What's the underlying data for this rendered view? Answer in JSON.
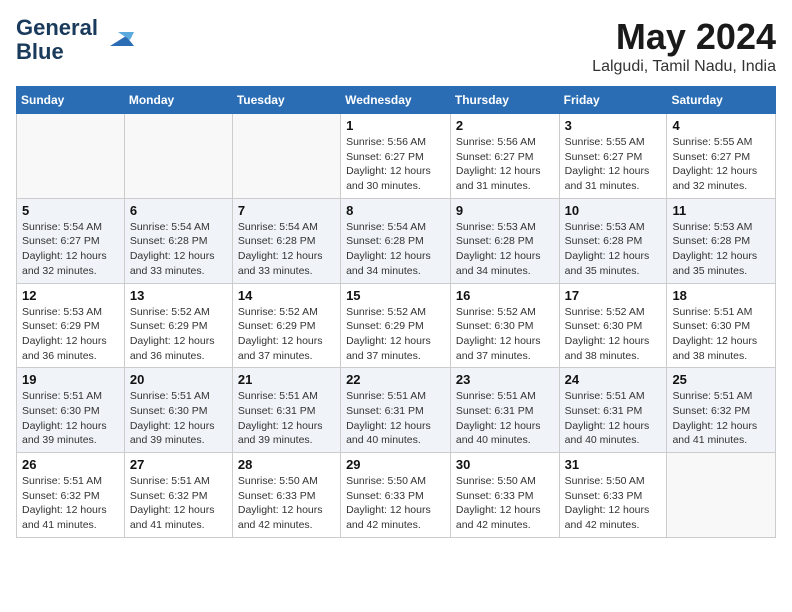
{
  "logo": {
    "line1": "General",
    "line2": "Blue"
  },
  "title": "May 2024",
  "subtitle": "Lalgudi, Tamil Nadu, India",
  "headers": [
    "Sunday",
    "Monday",
    "Tuesday",
    "Wednesday",
    "Thursday",
    "Friday",
    "Saturday"
  ],
  "weeks": [
    [
      {
        "day": "",
        "info": ""
      },
      {
        "day": "",
        "info": ""
      },
      {
        "day": "",
        "info": ""
      },
      {
        "day": "1",
        "info": "Sunrise: 5:56 AM\nSunset: 6:27 PM\nDaylight: 12 hours\nand 30 minutes."
      },
      {
        "day": "2",
        "info": "Sunrise: 5:56 AM\nSunset: 6:27 PM\nDaylight: 12 hours\nand 31 minutes."
      },
      {
        "day": "3",
        "info": "Sunrise: 5:55 AM\nSunset: 6:27 PM\nDaylight: 12 hours\nand 31 minutes."
      },
      {
        "day": "4",
        "info": "Sunrise: 5:55 AM\nSunset: 6:27 PM\nDaylight: 12 hours\nand 32 minutes."
      }
    ],
    [
      {
        "day": "5",
        "info": "Sunrise: 5:54 AM\nSunset: 6:27 PM\nDaylight: 12 hours\nand 32 minutes."
      },
      {
        "day": "6",
        "info": "Sunrise: 5:54 AM\nSunset: 6:28 PM\nDaylight: 12 hours\nand 33 minutes."
      },
      {
        "day": "7",
        "info": "Sunrise: 5:54 AM\nSunset: 6:28 PM\nDaylight: 12 hours\nand 33 minutes."
      },
      {
        "day": "8",
        "info": "Sunrise: 5:54 AM\nSunset: 6:28 PM\nDaylight: 12 hours\nand 34 minutes."
      },
      {
        "day": "9",
        "info": "Sunrise: 5:53 AM\nSunset: 6:28 PM\nDaylight: 12 hours\nand 34 minutes."
      },
      {
        "day": "10",
        "info": "Sunrise: 5:53 AM\nSunset: 6:28 PM\nDaylight: 12 hours\nand 35 minutes."
      },
      {
        "day": "11",
        "info": "Sunrise: 5:53 AM\nSunset: 6:28 PM\nDaylight: 12 hours\nand 35 minutes."
      }
    ],
    [
      {
        "day": "12",
        "info": "Sunrise: 5:53 AM\nSunset: 6:29 PM\nDaylight: 12 hours\nand 36 minutes."
      },
      {
        "day": "13",
        "info": "Sunrise: 5:52 AM\nSunset: 6:29 PM\nDaylight: 12 hours\nand 36 minutes."
      },
      {
        "day": "14",
        "info": "Sunrise: 5:52 AM\nSunset: 6:29 PM\nDaylight: 12 hours\nand 37 minutes."
      },
      {
        "day": "15",
        "info": "Sunrise: 5:52 AM\nSunset: 6:29 PM\nDaylight: 12 hours\nand 37 minutes."
      },
      {
        "day": "16",
        "info": "Sunrise: 5:52 AM\nSunset: 6:30 PM\nDaylight: 12 hours\nand 37 minutes."
      },
      {
        "day": "17",
        "info": "Sunrise: 5:52 AM\nSunset: 6:30 PM\nDaylight: 12 hours\nand 38 minutes."
      },
      {
        "day": "18",
        "info": "Sunrise: 5:51 AM\nSunset: 6:30 PM\nDaylight: 12 hours\nand 38 minutes."
      }
    ],
    [
      {
        "day": "19",
        "info": "Sunrise: 5:51 AM\nSunset: 6:30 PM\nDaylight: 12 hours\nand 39 minutes."
      },
      {
        "day": "20",
        "info": "Sunrise: 5:51 AM\nSunset: 6:30 PM\nDaylight: 12 hours\nand 39 minutes."
      },
      {
        "day": "21",
        "info": "Sunrise: 5:51 AM\nSunset: 6:31 PM\nDaylight: 12 hours\nand 39 minutes."
      },
      {
        "day": "22",
        "info": "Sunrise: 5:51 AM\nSunset: 6:31 PM\nDaylight: 12 hours\nand 40 minutes."
      },
      {
        "day": "23",
        "info": "Sunrise: 5:51 AM\nSunset: 6:31 PM\nDaylight: 12 hours\nand 40 minutes."
      },
      {
        "day": "24",
        "info": "Sunrise: 5:51 AM\nSunset: 6:31 PM\nDaylight: 12 hours\nand 40 minutes."
      },
      {
        "day": "25",
        "info": "Sunrise: 5:51 AM\nSunset: 6:32 PM\nDaylight: 12 hours\nand 41 minutes."
      }
    ],
    [
      {
        "day": "26",
        "info": "Sunrise: 5:51 AM\nSunset: 6:32 PM\nDaylight: 12 hours\nand 41 minutes."
      },
      {
        "day": "27",
        "info": "Sunrise: 5:51 AM\nSunset: 6:32 PM\nDaylight: 12 hours\nand 41 minutes."
      },
      {
        "day": "28",
        "info": "Sunrise: 5:50 AM\nSunset: 6:33 PM\nDaylight: 12 hours\nand 42 minutes."
      },
      {
        "day": "29",
        "info": "Sunrise: 5:50 AM\nSunset: 6:33 PM\nDaylight: 12 hours\nand 42 minutes."
      },
      {
        "day": "30",
        "info": "Sunrise: 5:50 AM\nSunset: 6:33 PM\nDaylight: 12 hours\nand 42 minutes."
      },
      {
        "day": "31",
        "info": "Sunrise: 5:50 AM\nSunset: 6:33 PM\nDaylight: 12 hours\nand 42 minutes."
      },
      {
        "day": "",
        "info": ""
      }
    ]
  ]
}
